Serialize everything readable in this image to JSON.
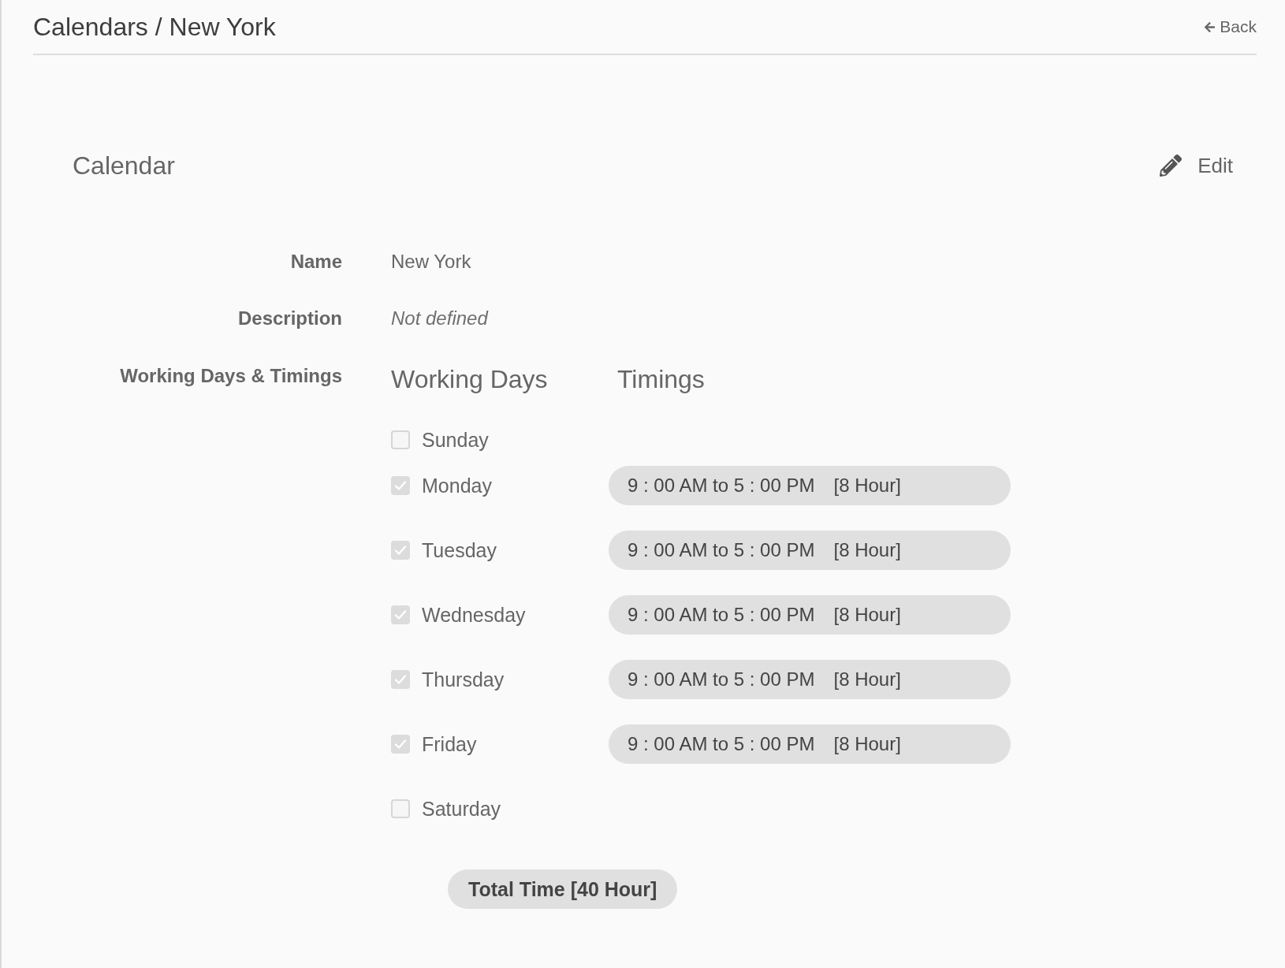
{
  "header": {
    "title": "Calendars / New York",
    "back_link": "Back"
  },
  "section": {
    "title": "Calendar",
    "edit_button": "Edit"
  },
  "fields": [
    {
      "label": "Name",
      "value": "New York",
      "kind": "text"
    },
    {
      "label": "Description",
      "value": "Not defined",
      "kind": "empty"
    }
  ],
  "schedule": {
    "label": "Working Days & Timings",
    "days_heading": "Working Days",
    "timings_heading": "Timings",
    "days": [
      {
        "name": "Sunday",
        "checked": false,
        "disabled": true
      },
      {
        "name": "Monday",
        "checked": true,
        "disabled": true,
        "timing": "9 : 00 AM to 5 : 00 PM",
        "hours": "[8 Hour]"
      },
      {
        "name": "Tuesday",
        "checked": true,
        "disabled": true,
        "timing": "9 : 00 AM to 5 : 00 PM",
        "hours": "[8 Hour]"
      },
      {
        "name": "Wednesday",
        "checked": true,
        "disabled": true,
        "timing": "9 : 00 AM to 5 : 00 PM",
        "hours": "[8 Hour]"
      },
      {
        "name": "Thursday",
        "checked": true,
        "disabled": true,
        "timing": "9 : 00 AM to 5 : 00 PM",
        "hours": "[8 Hour]"
      },
      {
        "name": "Friday",
        "checked": true,
        "disabled": true,
        "timing": "9 : 00 AM to 5 : 00 PM",
        "hours": "[8 Hour]"
      },
      {
        "name": "Saturday",
        "checked": false,
        "disabled": true
      }
    ],
    "total": "Total Time [40 Hour]"
  }
}
